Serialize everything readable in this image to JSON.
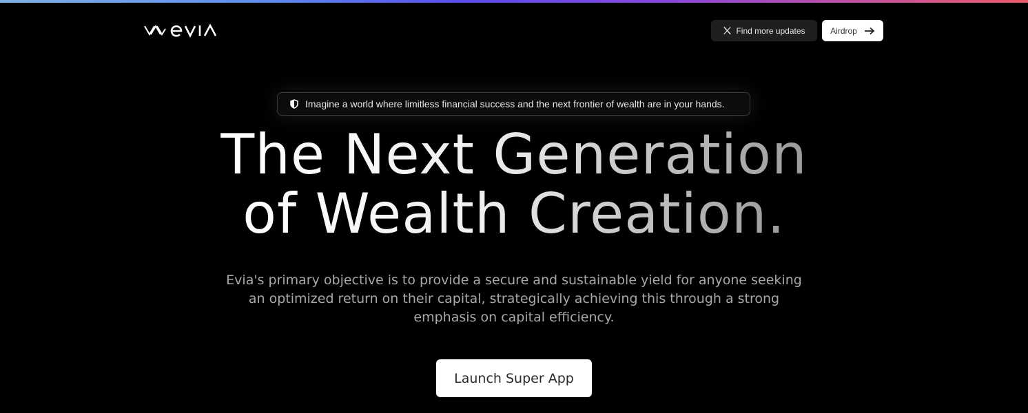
{
  "brand": {
    "logo_text": "evia",
    "top_bar_gradient": [
      "#7fb2e8",
      "#5a4cf0",
      "#8a45e0",
      "#ef5a6a"
    ]
  },
  "header": {
    "updates_button": {
      "icon": "x-logo-icon",
      "label": "Find more updates"
    },
    "airdrop_button": {
      "label": "Airdrop",
      "icon": "arrow-right-icon"
    }
  },
  "hero": {
    "badge": {
      "icon": "shield-icon",
      "text": "Imagine a world where limitless financial success and the next frontier of wealth are in your hands."
    },
    "headline_line1": "The Next Generation",
    "headline_line2": "of Wealth Creation.",
    "description": "Evia's primary objective is to provide a secure and sustainable yield for anyone seeking an optimized return on their capital, strategically achieving this through a strong emphasis on capital efficiency.",
    "cta_label": "Launch Super App"
  },
  "colors": {
    "background": "#000000",
    "button_dark": "#1f1f1f",
    "button_light": "#ffffff",
    "muted_text": "#a8a8a8"
  }
}
